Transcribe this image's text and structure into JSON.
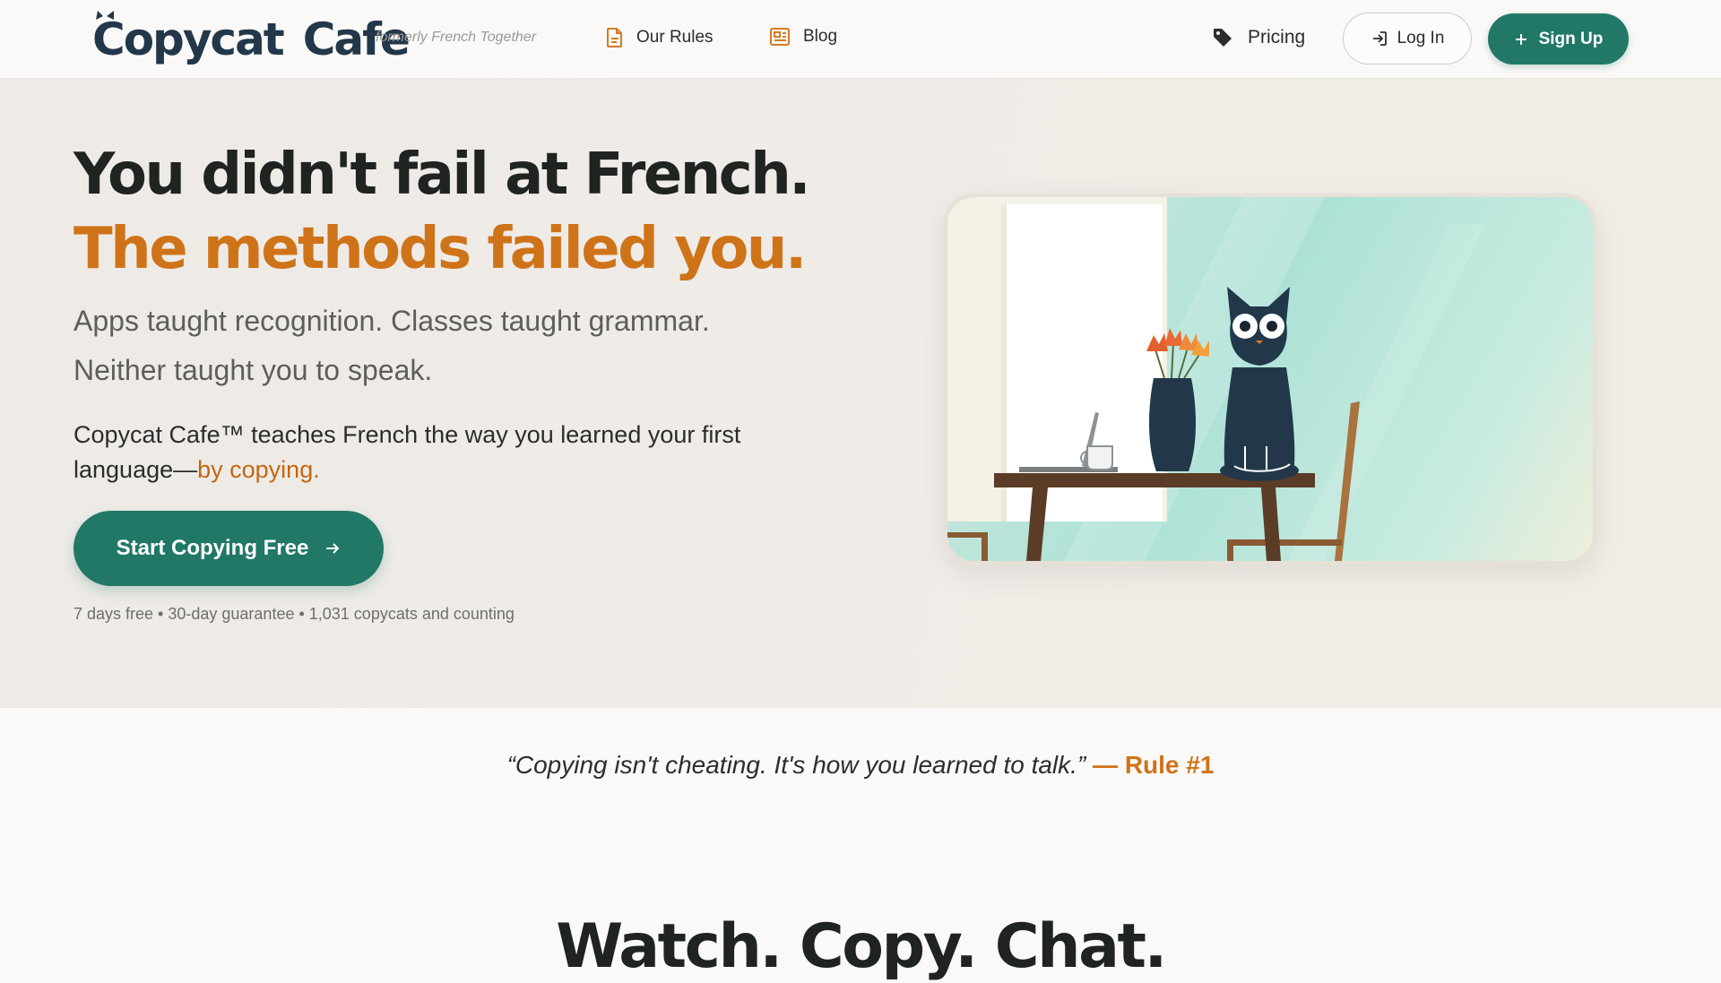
{
  "header": {
    "logo_word1": "Copycat",
    "logo_word2": "Cafe",
    "logo_sub": "formerly French Together",
    "nav": {
      "rules": "Our Rules",
      "blog": "Blog",
      "pricing": "Pricing"
    },
    "login_label": "Log In",
    "signup_label": "Sign Up"
  },
  "hero": {
    "title_line1": "You didn't fail at French.",
    "title_line2": "The methods failed you.",
    "sub_line1": "Apps taught recognition. Classes taught grammar.",
    "sub_line2": "Neither taught you to speak.",
    "desc_main": "Copycat Cafe™ teaches French the way you learned your first language—",
    "desc_highlight": "by copying.",
    "cta_label": "Start Copying Free",
    "meta": "7 days free • 30-day guarantee • 1,031 copycats and counting"
  },
  "quote": {
    "text": "“Copying isn't cheating. It's how you learned to talk.”",
    "attribution": "— Rule #1"
  },
  "section": {
    "heading": "Watch. Copy. Chat."
  },
  "colors": {
    "brand_teal": "#217867",
    "accent_orange": "#cf7319",
    "logo_navy": "#22384a"
  },
  "icons": {
    "rules": "document-icon",
    "blog": "newspaper-icon",
    "pricing": "tag-icon",
    "login": "login-icon",
    "signup": "plus-icon",
    "cta": "arrow-right-icon"
  }
}
